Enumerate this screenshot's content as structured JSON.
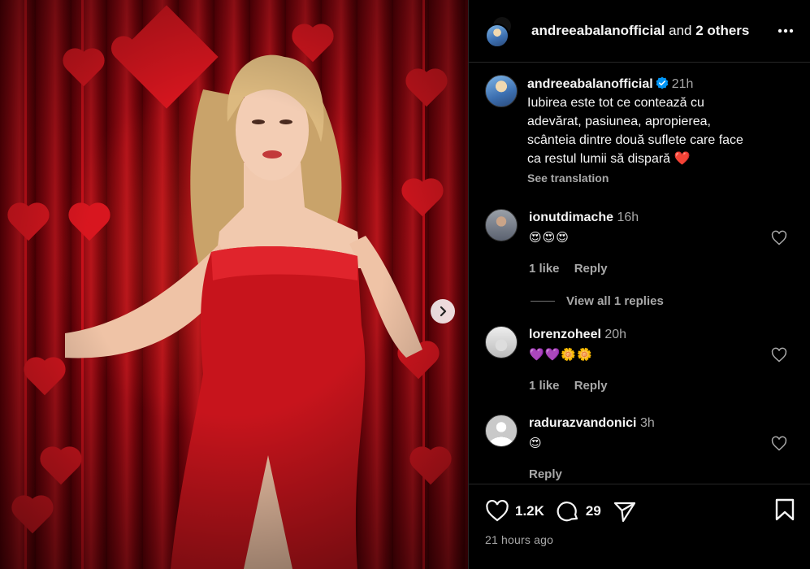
{
  "post": {
    "header": {
      "username": "andreeabalanofficial",
      "and_text": "and",
      "others": "2 others"
    },
    "caption": {
      "username": "andreeabalanofficial",
      "time": "21h",
      "lines": [
        "Iubirea este tot ce contează cu",
        "adevărat, pasiunea, apropierea,",
        "scânteia dintre două suflete care face",
        "ca restul lumii să dispară ❤️"
      ],
      "see_translation": "See translation"
    },
    "comments": [
      {
        "username": "ionutdimache",
        "time": "16h",
        "text": "😍😍😍",
        "likes": "1 like",
        "reply": "Reply",
        "view_replies": "View all 1 replies"
      },
      {
        "username": "lorenzoheel",
        "time": "20h",
        "text": "💜💜🌼🌼",
        "likes": "1 like",
        "reply": "Reply"
      },
      {
        "username": "radurazvandonici",
        "time": "3h",
        "text": "😍",
        "reply": "Reply"
      }
    ],
    "footer": {
      "likes_count": "1.2K",
      "comments_count": "29",
      "timestamp": "21 hours ago"
    },
    "colors": {
      "background": "#000000",
      "text": "#f5f5f5",
      "muted": "#a8a8a8",
      "verified": "#0095f6"
    },
    "icons": [
      "more-icon",
      "verified-icon",
      "heart-icon",
      "comment-icon",
      "share-icon",
      "bookmark-icon",
      "chevron-right-icon"
    ]
  }
}
